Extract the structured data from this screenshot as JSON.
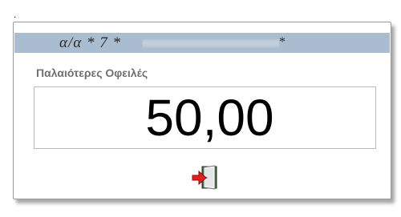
{
  "page": {
    "mark": "."
  },
  "header": {
    "prefix": "α/α * 7 *",
    "suffix_mark": "*",
    "bar_color": "#a9bcd0"
  },
  "section": {
    "label": "Παλαιότερες Οφειλές"
  },
  "amount": {
    "value": "50,00"
  },
  "actions": {
    "exit_icon": "exit-door-icon"
  }
}
